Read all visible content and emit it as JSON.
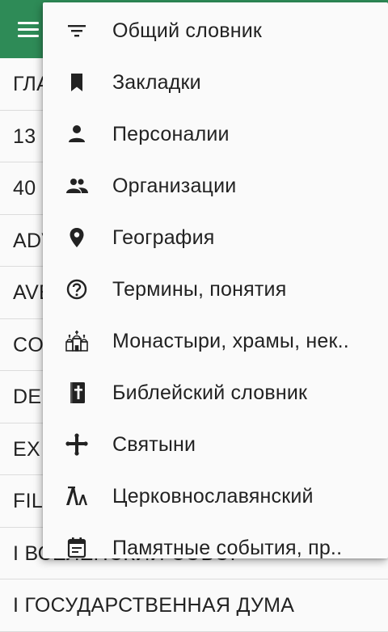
{
  "app": {
    "menu_icon": "hamburger-icon",
    "accent": "#2e8b57"
  },
  "list": {
    "items": [
      {
        "text": "ГЛАВА"
      },
      {
        "text": "13"
      },
      {
        "text": "40"
      },
      {
        "text": "ADV"
      },
      {
        "text": "AVE"
      },
      {
        "text": "COR"
      },
      {
        "text": "DEI"
      },
      {
        "text": "EX"
      },
      {
        "text": "FILI"
      },
      {
        "text": "I ВСЕЛЕНСКИЙ СОБОР"
      },
      {
        "text": "I ГОСУДАРСТВЕННАЯ ДУМА"
      }
    ]
  },
  "menu": {
    "items": [
      {
        "label": "Общий словник",
        "icon": "filter-list-icon"
      },
      {
        "label": "Закладки",
        "icon": "bookmark-icon"
      },
      {
        "label": "Персоналии",
        "icon": "person-icon"
      },
      {
        "label": "Организации",
        "icon": "people-icon"
      },
      {
        "label": "География",
        "icon": "location-pin-icon"
      },
      {
        "label": "Термины, понятия",
        "icon": "help-circle-icon"
      },
      {
        "label": "Монастыри, храмы, нек..",
        "icon": "church-icon"
      },
      {
        "label": "Библейский словник",
        "icon": "bible-icon"
      },
      {
        "label": "Святыни",
        "icon": "cross-icon"
      },
      {
        "label": "Церковнославянский",
        "icon": "old-slavonic-letter-icon"
      },
      {
        "label": "Памятные события, пр..",
        "icon": "calendar-event-icon"
      }
    ]
  }
}
